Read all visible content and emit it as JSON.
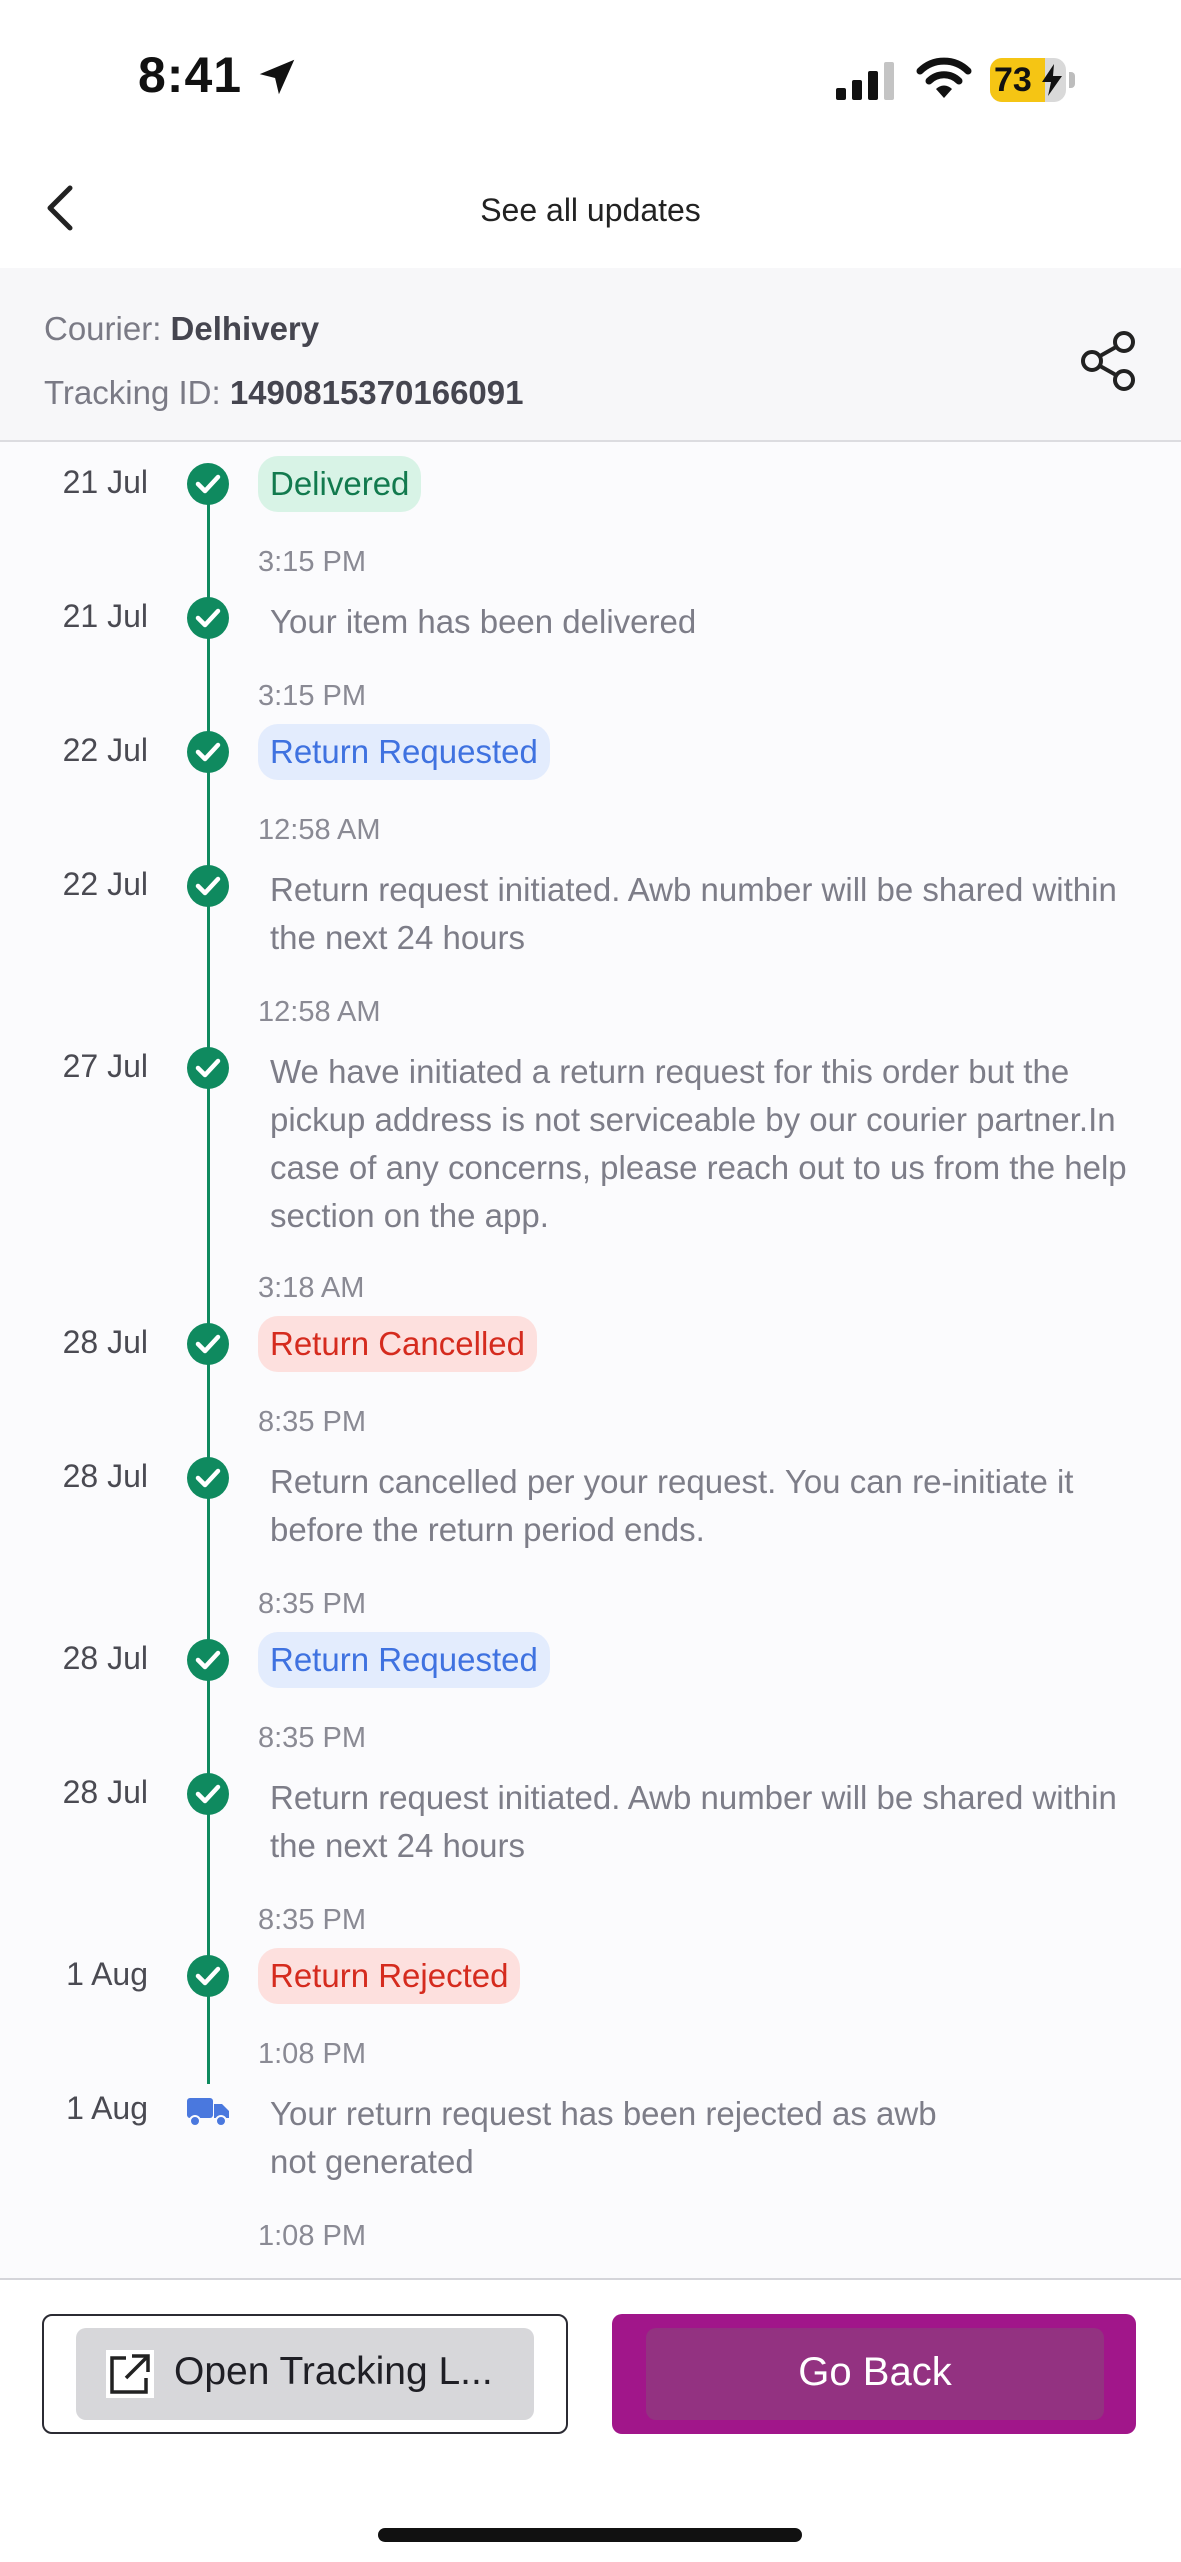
{
  "status_bar": {
    "time": "8:41",
    "battery_percent": "73",
    "battery_level": 0.73,
    "icons": [
      "location-arrow-icon",
      "cellular-signal-icon",
      "wifi-icon",
      "battery-charging-icon"
    ]
  },
  "header": {
    "title": "See all updates",
    "back_icon": "chevron-left-icon"
  },
  "courier": {
    "courier_label": "Courier:",
    "courier_name": "Delhivery",
    "tracking_label": "Tracking ID:",
    "tracking_id": "1490815370166091",
    "share_icon": "share-icon"
  },
  "events": [
    {
      "date": "21 Jul",
      "type": "badge",
      "text": "Delivered",
      "time": "3:15 PM",
      "icon": "check-circle-icon"
    },
    {
      "date": "21 Jul",
      "type": "text",
      "text": "Your item has been delivered",
      "time": "3:15 PM",
      "icon": "check-circle-icon"
    },
    {
      "date": "22 Jul",
      "type": "badge",
      "text": "Return Requested",
      "time": "12:58 AM",
      "icon": "check-circle-icon"
    },
    {
      "date": "22 Jul",
      "type": "text",
      "text": "Return request initiated. Awb number will be shared within the next 24 hours",
      "time": "12:58 AM",
      "icon": "check-circle-icon"
    },
    {
      "date": "27 Jul",
      "type": "text",
      "text": "We have initiated a return request for this order but the pickup address is not serviceable by our courier partner.In case of any concerns, please reach out to us from the help section on the app.",
      "time": "3:18 AM",
      "icon": "check-circle-icon"
    },
    {
      "date": "28 Jul",
      "type": "badge",
      "text": "Return Cancelled",
      "time": "8:35 PM",
      "icon": "check-circle-icon"
    },
    {
      "date": "28 Jul",
      "type": "text",
      "text": "Return cancelled per your request. You can re-initiate it before the return period ends.",
      "time": "8:35 PM",
      "icon": "check-circle-icon"
    },
    {
      "date": "28 Jul",
      "type": "badge",
      "text": "Return Requested",
      "time": "8:35 PM",
      "icon": "check-circle-icon"
    },
    {
      "date": "28 Jul",
      "type": "text",
      "text": "Return request initiated. Awb number will be shared within the next 24 hours",
      "time": "8:35 PM",
      "icon": "check-circle-icon"
    },
    {
      "date": "1 Aug",
      "type": "badge",
      "text": "Return Rejected",
      "time": "1:08 PM",
      "icon": "check-circle-icon"
    },
    {
      "date": "1 Aug",
      "type": "text",
      "text": "Your return request has been rejected as awb not generated",
      "time": "1:08 PM",
      "icon": "delivery-truck-icon"
    }
  ],
  "colors": {
    "timeline_green": "#0f8a5f",
    "delivered_badge": "#d8f3e6",
    "requested_badge": "#e3ecfd",
    "cancelled_badge": "#fde0de",
    "primary_button": "#a1168a",
    "truck_blue": "#4a78de"
  },
  "actions": {
    "open_tracking_label": "Open Tracking L...",
    "open_tracking_icon": "external-link-icon",
    "go_back_label": "Go Back"
  }
}
